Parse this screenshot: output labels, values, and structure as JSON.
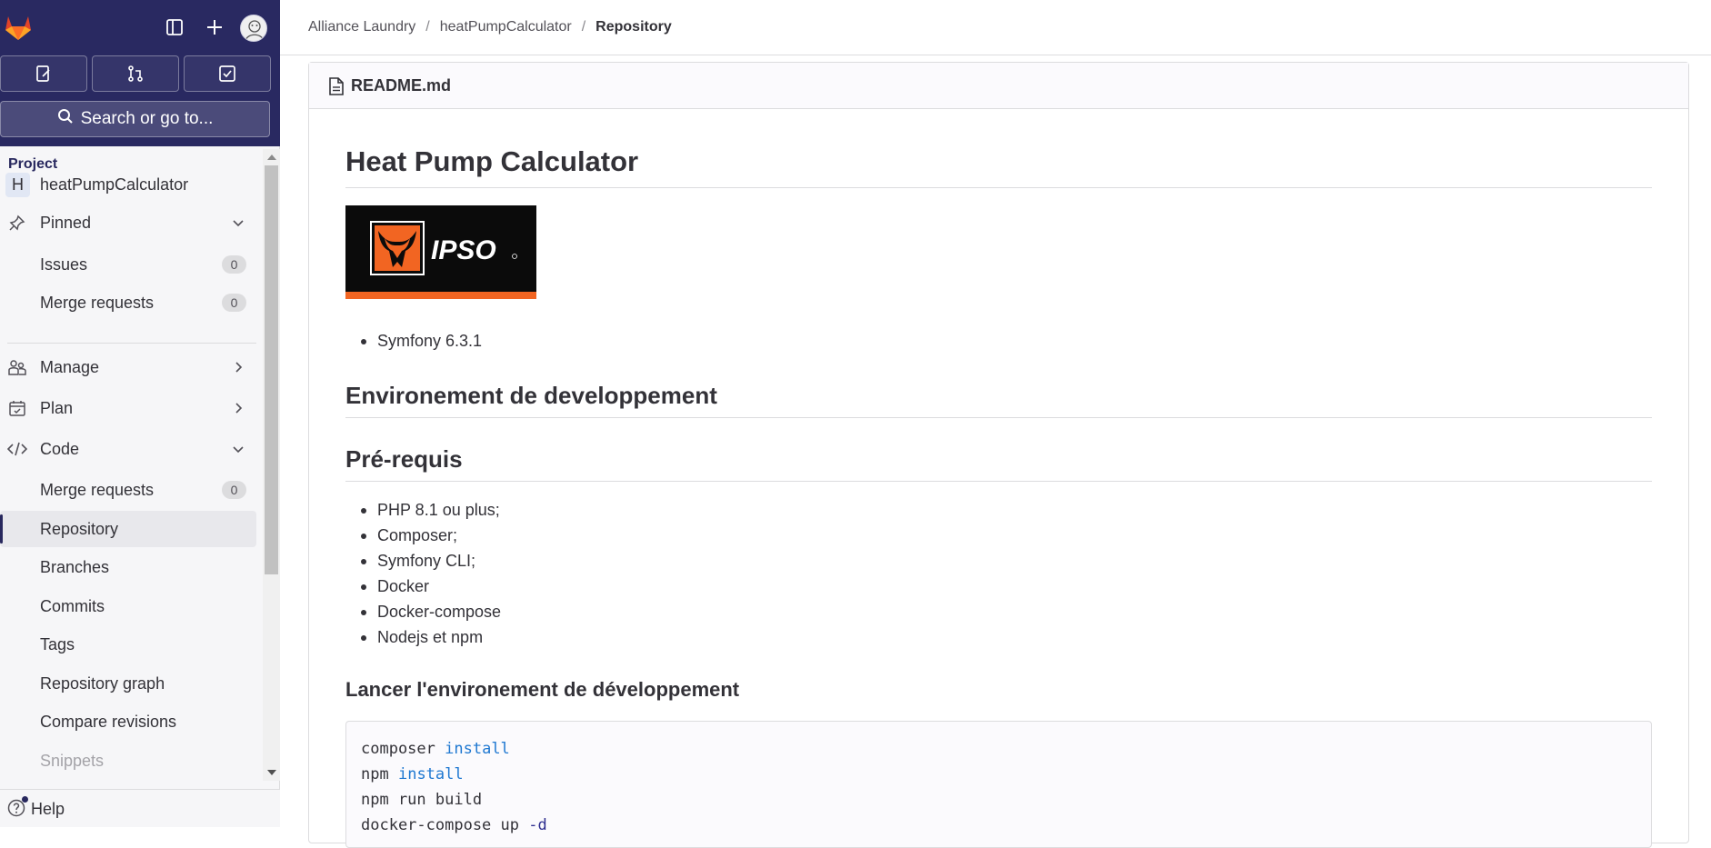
{
  "sidebar": {
    "search_label": "Search or go to...",
    "section_title": "Project",
    "project": {
      "avatar_letter": "H",
      "name": "heatPumpCalculator"
    },
    "pinned_label": "Pinned",
    "pinned_items": [
      {
        "label": "Issues",
        "count": "0"
      },
      {
        "label": "Merge requests",
        "count": "0"
      }
    ],
    "groups": [
      {
        "label": "Manage"
      },
      {
        "label": "Plan"
      },
      {
        "label": "Code"
      }
    ],
    "code_items": [
      {
        "label": "Merge requests",
        "count": "0"
      },
      {
        "label": "Repository"
      },
      {
        "label": "Branches"
      },
      {
        "label": "Commits"
      },
      {
        "label": "Tags"
      },
      {
        "label": "Repository graph"
      },
      {
        "label": "Compare revisions"
      },
      {
        "label": "Snippets"
      }
    ],
    "help_label": "Help",
    "colors": {
      "top_bg": "#292961",
      "accent": "#28285e"
    }
  },
  "breadcrumb": {
    "items": [
      "Alliance Laundry",
      "heatPumpCalculator"
    ],
    "current": "Repository"
  },
  "file": {
    "name": "README.md"
  },
  "readme": {
    "title": "Heat Pump Calculator",
    "logo_text": "IPSO",
    "intro_list": [
      "Symfony 6.3.1"
    ],
    "h2_env": "Environement de developpement",
    "h2_prereq": "Pré-requis",
    "prereq_list": [
      "PHP 8.1 ou plus;",
      "Composer;",
      "Symfony CLI;",
      "Docker",
      "Docker-compose",
      "Nodejs et npm"
    ],
    "h3_launch": "Lancer l'environement de développement",
    "code_lines": [
      {
        "cmd": "composer",
        "arg": "install"
      },
      {
        "cmd": "npm",
        "arg": "install"
      },
      {
        "cmd": "npm run build",
        "arg": ""
      },
      {
        "cmd": "docker-compose up",
        "arg": "-d"
      }
    ]
  }
}
